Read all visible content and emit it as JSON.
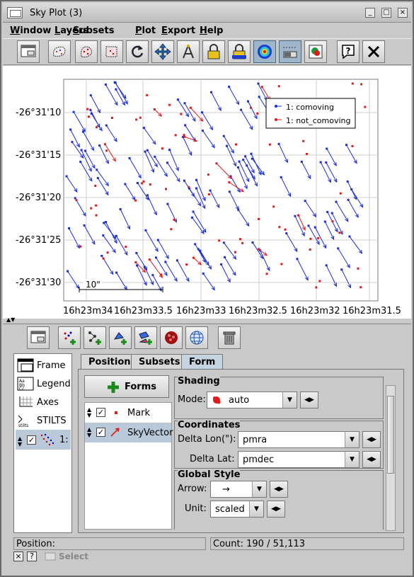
{
  "window": {
    "title": "Sky Plot (3)",
    "controls": [
      "_",
      "□",
      "×"
    ]
  },
  "menu": [
    "Window",
    "Layers",
    "Subsets",
    "Plot",
    "Export",
    "Help"
  ],
  "toolbar_icons": [
    "new-window-icon",
    "blob-subset-icon",
    "points-subset-icon",
    "region-subset-icon",
    "reset-view-icon",
    "pan-zoom-icon",
    "axis-lock-icon",
    "lock-aspect-icon",
    "set-alpha-icon",
    "sketch-icon",
    "progress-icon",
    "export-image-icon",
    "help-icon",
    "close-icon"
  ],
  "plot": {
    "y_ticks": [
      "-26°31'10",
      "-26°31'15",
      "-26°31'20",
      "-26°31'25",
      "-26°31'30"
    ],
    "x_ticks": [
      "16h23m34",
      "16h23m33.5",
      "16h23m33",
      "16h23m32.5",
      "16h23m32",
      "16h23m31.5"
    ],
    "scale_bar": "10\"",
    "legend": [
      {
        "label": "1: comoving",
        "color": "#1a2dd6"
      },
      {
        "label": "1: not_comoving",
        "color": "#e11b1b"
      }
    ]
  },
  "control_toolbar": [
    "window-icon",
    "add-position-icon",
    "add-pair-icon",
    "add-vector-icon",
    "add-area-icon",
    "add-density-icon",
    "add-sky-icon",
    "delete-icon"
  ],
  "left_panel": {
    "items": [
      {
        "label": "Frame"
      },
      {
        "label": "Legend"
      },
      {
        "label": "Axes"
      },
      {
        "label": "STILTS"
      },
      {
        "label": "1:"
      }
    ]
  },
  "tabs": [
    "Position",
    "Subsets",
    "Form"
  ],
  "forms_button": "Forms",
  "form_list": [
    {
      "label": "Mark",
      "checked": true
    },
    {
      "label": "SkyVector",
      "checked": true
    }
  ],
  "shading": {
    "title": "Shading",
    "mode_label": "Mode:",
    "mode_value": "auto"
  },
  "coordinates": {
    "title": "Coordinates",
    "lon_label": "Delta Lon(\"):",
    "lon_value": "pmra",
    "lat_label": "Delta Lat:",
    "lat_value": "pmdec"
  },
  "global_style": {
    "title": "Global Style",
    "arrow_label": "Arrow:",
    "arrow_value": "→",
    "unit_label": "Unit:",
    "unit_value": "scaled"
  },
  "status": {
    "position_label": "Position:",
    "count": "Count: 190 / 51,113"
  },
  "bottom": {
    "select_label": "Select"
  }
}
